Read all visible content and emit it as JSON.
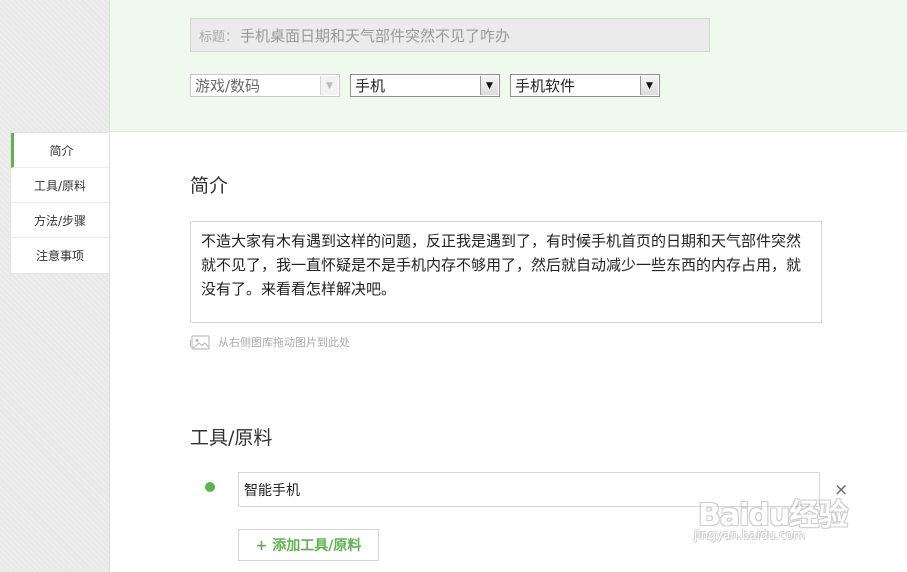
{
  "header": {
    "title_prefix": "标题：",
    "title_value": "手机桌面日期和天气部件突然不见了咋办",
    "category_1": "游戏/数码",
    "category_2": "手机",
    "category_3": "手机软件"
  },
  "sidebar": {
    "items": [
      {
        "label": "简介",
        "active": true
      },
      {
        "label": "工具/原料",
        "active": false
      },
      {
        "label": "方法/步骤",
        "active": false
      },
      {
        "label": "注意事项",
        "active": false
      }
    ]
  },
  "intro": {
    "heading": "简介",
    "text": "不造大家有木有遇到这样的问题，反正我是遇到了，有时候手机首页的日期和天气部件突然就不见了，我一直怀疑是不是手机内存不够用了，然后就自动减少一些东西的内存占用，就没有了。来看看怎样解决吧。",
    "drag_hint": "从右侧图库拖动图片到此处"
  },
  "tools": {
    "heading": "工具/原料",
    "items": [
      "智能手机"
    ],
    "remove_label": "×",
    "add_label": "+ 添加工具/原料"
  },
  "watermark": {
    "logo_text": "Baidu经验",
    "url": "jingyan.baidu.com"
  },
  "colors": {
    "accent_green": "#5fb34d",
    "header_bg": "#f0f9ee"
  },
  "icons": {
    "select_arrow": "chevron-down-icon",
    "image": "image-icon",
    "bullet": "bullet-dot-icon",
    "remove": "close-icon"
  }
}
